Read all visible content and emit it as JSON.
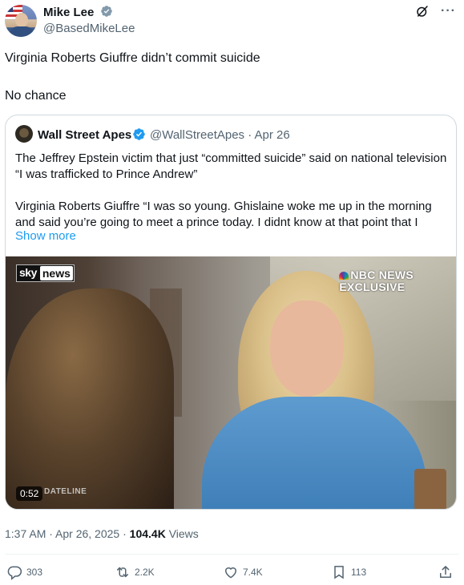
{
  "author": {
    "name": "Mike Lee",
    "handle": "@BasedMikeLee",
    "verified_icon": "verified-badge-icon"
  },
  "tweet": {
    "line1": "Virginia Roberts Giuffre didn’t commit suicide",
    "line2": "No chance"
  },
  "quote": {
    "name": "Wall Street Apes",
    "handle": "@WallStreetApes · Apr 26",
    "para1": "The Jeffrey Epstein victim that just “committed suicide” said on national television “I was trafficked to Prince Andrew”",
    "para2": "Virginia Roberts Giuffre “I was so young. Ghislaine woke me up in the morning and said you’re going to meet a prince today. I didnt know at that point that I",
    "show_more": "Show more",
    "video": {
      "sky_left": "sky",
      "sky_right": "news",
      "nbc_line1": "NBC NEWS",
      "nbc_line2": "EXCLUSIVE",
      "dateline": "DATELINE",
      "duration": "0:52"
    }
  },
  "meta": {
    "time_date": "1:37 AM · Apr 26, 2025 · ",
    "views_count": "104.4K",
    "views_label": " Views"
  },
  "actions": {
    "replies": "303",
    "reposts": "2.2K",
    "likes": "7.4K",
    "bookmarks": "113"
  },
  "colors": {
    "link": "#1d9bf0",
    "secondary_text": "#536471",
    "primary_text": "#0f1419"
  }
}
